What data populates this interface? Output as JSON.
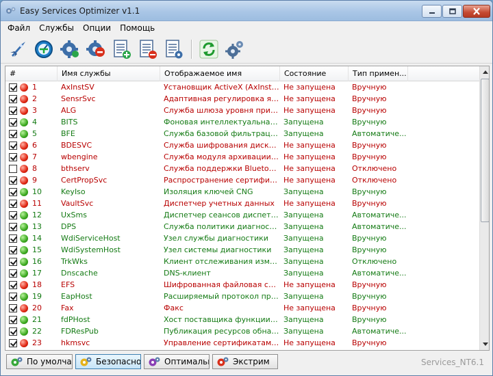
{
  "window": {
    "title": "Easy Services Optimizer v1.1"
  },
  "menu": [
    "Файл",
    "Службы",
    "Опции",
    "Помощь"
  ],
  "toolbar": {
    "buttons": [
      "rocket-icon",
      "speedometer-icon",
      "gear-apply-icon",
      "gear-stop-icon",
      "list-add-icon",
      "list-remove-icon",
      "list-settings-icon",
      "refresh-icon",
      "settings-gear-icon"
    ]
  },
  "columns": [
    "#",
    "Имя службы",
    "Отображаемое имя",
    "Состояние",
    "Тип примен..."
  ],
  "rows": [
    {
      "checked": true,
      "running": false,
      "num": "1",
      "name": "AxInstSV",
      "display": "Установщик ActiveX (AxInstSV)",
      "state": "Не запущена",
      "start": "Вручную"
    },
    {
      "checked": true,
      "running": false,
      "num": "2",
      "name": "SensrSvc",
      "display": "Адаптивная регулировка ярк...",
      "state": "Не запущена",
      "start": "Вручную"
    },
    {
      "checked": true,
      "running": false,
      "num": "3",
      "name": "ALG",
      "display": "Служба шлюза уровня прило...",
      "state": "Не запущена",
      "start": "Вручную"
    },
    {
      "checked": true,
      "running": true,
      "num": "4",
      "name": "BITS",
      "display": "Фоновая интеллектуальная с...",
      "state": "Запущена",
      "start": "Вручную"
    },
    {
      "checked": true,
      "running": true,
      "num": "5",
      "name": "BFE",
      "display": "Служба базовой фильтрации",
      "state": "Запущена",
      "start": "Автоматиче..."
    },
    {
      "checked": true,
      "running": false,
      "num": "6",
      "name": "BDESVC",
      "display": "Служба шифрования дисков ...",
      "state": "Не запущена",
      "start": "Вручную"
    },
    {
      "checked": true,
      "running": false,
      "num": "7",
      "name": "wbengine",
      "display": "Служба модуля архивации на...",
      "state": "Не запущена",
      "start": "Вручную"
    },
    {
      "checked": false,
      "running": false,
      "num": "8",
      "name": "bthserv",
      "display": "Служба поддержки Bluetooth",
      "state": "Не запущена",
      "start": "Отключено"
    },
    {
      "checked": true,
      "running": false,
      "num": "9",
      "name": "CertPropSvc",
      "display": "Распространение сертификата",
      "state": "Не запущена",
      "start": "Отключено"
    },
    {
      "checked": true,
      "running": true,
      "num": "10",
      "name": "KeyIso",
      "display": "Изоляция ключей CNG",
      "state": "Запущена",
      "start": "Вручную"
    },
    {
      "checked": true,
      "running": false,
      "num": "11",
      "name": "VaultSvc",
      "display": "Диспетчер учетных данных",
      "state": "Не запущена",
      "start": "Вручную"
    },
    {
      "checked": true,
      "running": true,
      "num": "12",
      "name": "UxSms",
      "display": "Диспетчер сеансов диспетче...",
      "state": "Запущена",
      "start": "Автоматиче..."
    },
    {
      "checked": true,
      "running": true,
      "num": "13",
      "name": "DPS",
      "display": "Служба политики диагностики",
      "state": "Запущена",
      "start": "Автоматиче..."
    },
    {
      "checked": true,
      "running": true,
      "num": "14",
      "name": "WdiServiceHost",
      "display": "Узел службы диагностики",
      "state": "Запущена",
      "start": "Вручную"
    },
    {
      "checked": true,
      "running": true,
      "num": "15",
      "name": "WdiSystemHost",
      "display": "Узел системы диагностики",
      "state": "Запущена",
      "start": "Вручную"
    },
    {
      "checked": true,
      "running": true,
      "num": "16",
      "name": "TrkWks",
      "display": "Клиент отслеживания измени...",
      "state": "Запущена",
      "start": "Отключено"
    },
    {
      "checked": true,
      "running": true,
      "num": "17",
      "name": "Dnscache",
      "display": "DNS-клиент",
      "state": "Запущена",
      "start": "Автоматиче..."
    },
    {
      "checked": true,
      "running": false,
      "num": "18",
      "name": "EFS",
      "display": "Шифрованная файловая сист...",
      "state": "Не запущена",
      "start": "Вручную"
    },
    {
      "checked": true,
      "running": true,
      "num": "19",
      "name": "EapHost",
      "display": "Расширяемый протокол пров...",
      "state": "Запущена",
      "start": "Вручную"
    },
    {
      "checked": true,
      "running": false,
      "num": "20",
      "name": "Fax",
      "display": "Факс",
      "state": "Не запущена",
      "start": "Вручную"
    },
    {
      "checked": true,
      "running": true,
      "num": "21",
      "name": "fdPHost",
      "display": "Хост поставщика функции об...",
      "state": "Запущена",
      "start": "Вручную"
    },
    {
      "checked": true,
      "running": true,
      "num": "22",
      "name": "FDResPub",
      "display": "Публикация ресурсов обнару...",
      "state": "Запущена",
      "start": "Автоматиче..."
    },
    {
      "checked": true,
      "running": false,
      "num": "23",
      "name": "hkmsvc",
      "display": "Управление сертификатами ...",
      "state": "Не запущена",
      "start": "Вручную"
    }
  ],
  "modes": [
    {
      "label": "По умолчанию",
      "icon": "gear-green-icon",
      "active": false
    },
    {
      "label": "Безопасно",
      "icon": "gear-yellow-icon",
      "active": true
    },
    {
      "label": "Оптимально",
      "icon": "gear-purple-icon",
      "active": false
    },
    {
      "label": "Экстрим",
      "icon": "gear-red-icon",
      "active": false
    }
  ],
  "status": "Services_NT6.1",
  "colors": {
    "stopped_text": "#b80000",
    "running_text": "#137a13",
    "accent": "#3c7fb1"
  }
}
